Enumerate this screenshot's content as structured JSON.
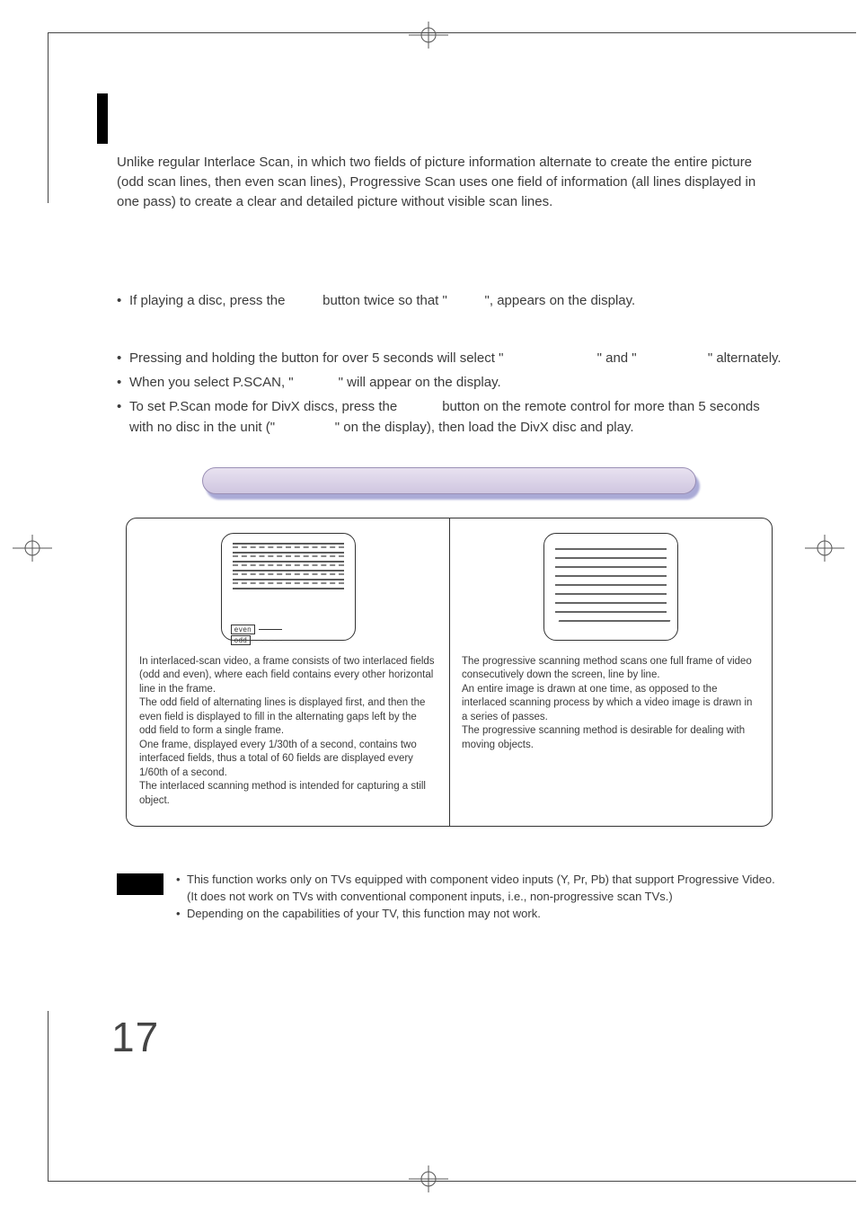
{
  "intro": "Unlike regular Interlace Scan, in which two fields of picture information alternate to create the entire picture (odd scan lines, then even scan lines), Progressive Scan uses one field of information (all lines displayed in one pass) to create a clear and detailed picture without visible scan lines.",
  "bullets": {
    "b1_a": "If playing a disc, press the ",
    "b1_b": " button twice so that \"",
    "b1_c": "\", appears on the display.",
    "b2_a": "Pressing and holding the button for over 5 seconds will select \"",
    "b2_b": "\" and \"",
    "b2_c": "\" alternately.",
    "b3_a": "When you select P.SCAN, \"",
    "b3_b": "\" will appear on the display.",
    "b4_a": "To set P.Scan mode for DivX discs, press the ",
    "b4_b": " button on the remote control for more than 5 seconds with no disc in the unit (\"",
    "b4_c": "\" on the display), then load the DivX disc and play."
  },
  "interlaced": {
    "label_even": "even",
    "label_odd": "odd",
    "p1": "In interlaced-scan video, a frame consists of two interlaced fields (odd and even), where each field contains every other horizontal line in the frame.",
    "p2": "The odd field of alternating lines is displayed first, and then the even field is displayed to fill in the alternating gaps left by the odd field to form a single frame.",
    "p3": "One frame, displayed every 1/30th of a second, contains two interfaced fields, thus a total of 60 fields are displayed every 1/60th of a second.",
    "p4": "The interlaced scanning method is intended for capturing a still object."
  },
  "progressive": {
    "p1": "The progressive scanning method scans one full frame of video consecutively down the screen, line by line.",
    "p2": "An entire image is drawn at one time, as opposed to the interlaced scanning process by which a video image is drawn in a series of passes.",
    "p3": "The progressive scanning method is desirable for dealing with moving objects."
  },
  "note": {
    "n1": "This function works only on TVs equipped with component video inputs (Y, Pr, Pb) that support Progressive Video. (It does not work on TVs with conventional component inputs, i.e., non-progressive scan TVs.)",
    "n2": "Depending on the capabilities of your TV, this function may not work."
  },
  "page_number": "17"
}
